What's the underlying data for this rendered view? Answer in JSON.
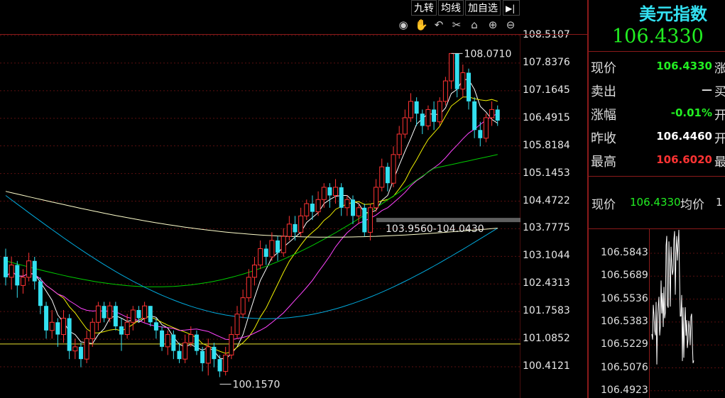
{
  "toolbar": {
    "jiuzhuan": "九转",
    "junxian": "均线",
    "add_watch": "加自选",
    "arrow": "▶|"
  },
  "icons": [
    "eye-icon",
    "hand-icon",
    "undo-icon",
    "scissors-icon",
    "lock-icon",
    "zoom-in-icon",
    "zoom-out-icon"
  ],
  "quote": {
    "title": "美元指数",
    "price": "106.4330",
    "rows": [
      {
        "label": "现价",
        "value": "106.4330",
        "color": "#22ee22",
        "tail": "涨"
      },
      {
        "label": "卖出",
        "value": "—",
        "color": "#dddddd",
        "tail": "买"
      },
      {
        "label": "涨幅",
        "value": "-0.01%",
        "color": "#22ee22",
        "tail": "开"
      },
      {
        "label": "昨收",
        "value": "106.4460",
        "color": "#ffffff",
        "tail": "开"
      },
      {
        "label": "最高",
        "value": "106.6020",
        "color": "#ff3333",
        "tail": "最"
      }
    ]
  },
  "mini": {
    "label_now": "现价",
    "now": "106.4330",
    "label_avg": "均价",
    "avg": "1"
  },
  "colors": {
    "up": "#ff3333",
    "down": "#33e0f0",
    "ma5": "#ffffff",
    "ma10": "#f0f000",
    "ma20": "#ff44ff",
    "ma30": "#00cc00",
    "ma60": "#00aadd",
    "ma120": "#ffffcc"
  },
  "chart_data": {
    "type": "candlestick",
    "yticks": [
      "108.5107",
      "107.8376",
      "107.1645",
      "106.4915",
      "105.8184",
      "105.1453",
      "104.4722",
      "103.7775",
      "103.1044",
      "102.4313",
      "101.7583",
      "101.0852",
      "100.4121"
    ],
    "ylim": [
      100.1,
      108.6
    ],
    "annotations": {
      "high_label": "108.0710",
      "low_label": "100.1570",
      "range_label": "103.9560-104.0430",
      "range_level": 104.0,
      "hline_level": 100.97
    },
    "candles": [
      [
        103.1,
        102.6,
        103.3,
        102.4
      ],
      [
        102.6,
        102.9,
        103.1,
        102.3
      ],
      [
        102.9,
        102.4,
        103.0,
        102.1
      ],
      [
        102.4,
        102.6,
        102.8,
        102.2
      ],
      [
        102.6,
        103.0,
        103.2,
        102.5
      ],
      [
        103.0,
        102.5,
        103.1,
        102.3
      ],
      [
        102.5,
        101.9,
        102.6,
        101.7
      ],
      [
        101.9,
        101.3,
        102.0,
        101.1
      ],
      [
        101.3,
        101.5,
        101.8,
        101.1
      ],
      [
        101.5,
        101.2,
        101.6,
        100.9
      ],
      [
        101.2,
        101.6,
        101.8,
        101.0
      ],
      [
        101.6,
        100.8,
        101.7,
        100.6
      ],
      [
        100.8,
        100.9,
        101.1,
        100.6
      ],
      [
        100.9,
        100.6,
        101.0,
        100.4
      ],
      [
        100.6,
        101.1,
        101.3,
        100.5
      ],
      [
        101.1,
        101.5,
        101.6,
        100.9
      ],
      [
        101.5,
        101.9,
        102.0,
        101.3
      ],
      [
        101.9,
        101.6,
        102.0,
        101.5
      ],
      [
        101.6,
        101.9,
        102.0,
        101.5
      ],
      [
        101.9,
        101.4,
        102.0,
        101.3
      ],
      [
        101.4,
        101.2,
        101.6,
        100.8
      ],
      [
        101.2,
        101.5,
        101.7,
        101.1
      ],
      [
        101.5,
        101.8,
        101.9,
        101.3
      ],
      [
        101.8,
        101.6,
        101.9,
        101.5
      ],
      [
        101.6,
        101.9,
        102.0,
        101.5
      ],
      [
        101.9,
        101.5,
        101.9,
        101.4
      ],
      [
        101.5,
        101.3,
        101.6,
        101.1
      ],
      [
        101.3,
        100.9,
        101.4,
        100.8
      ],
      [
        100.9,
        101.2,
        101.3,
        100.7
      ],
      [
        101.2,
        100.8,
        101.3,
        100.6
      ],
      [
        100.8,
        100.6,
        101.0,
        100.5
      ],
      [
        100.6,
        101.0,
        101.2,
        100.5
      ],
      [
        101.0,
        101.2,
        101.4,
        100.9
      ],
      [
        101.2,
        100.8,
        101.3,
        100.7
      ],
      [
        100.8,
        100.5,
        100.9,
        100.3
      ],
      [
        100.5,
        100.9,
        101.1,
        100.2
      ],
      [
        100.9,
        100.6,
        101.0,
        100.4
      ],
      [
        100.6,
        100.3,
        100.7,
        100.16
      ],
      [
        100.3,
        100.7,
        100.9,
        100.2
      ],
      [
        100.7,
        101.2,
        101.4,
        100.6
      ],
      [
        101.2,
        101.7,
        101.9,
        101.1
      ],
      [
        101.7,
        102.1,
        102.3,
        101.6
      ],
      [
        102.1,
        102.6,
        102.8,
        102.0
      ],
      [
        102.6,
        102.9,
        103.1,
        102.4
      ],
      [
        102.9,
        103.3,
        103.5,
        102.8
      ],
      [
        103.3,
        103.1,
        103.4,
        102.9
      ],
      [
        103.1,
        103.5,
        103.7,
        103.0
      ],
      [
        103.5,
        103.2,
        103.6,
        103.0
      ],
      [
        103.2,
        103.6,
        103.8,
        103.1
      ],
      [
        103.6,
        103.9,
        104.1,
        103.5
      ],
      [
        103.9,
        103.7,
        104.1,
        103.5
      ],
      [
        103.7,
        104.1,
        104.3,
        103.6
      ],
      [
        104.1,
        104.4,
        104.5,
        104.0
      ],
      [
        104.4,
        104.2,
        104.6,
        104.0
      ],
      [
        104.2,
        104.5,
        104.7,
        104.1
      ],
      [
        104.5,
        104.8,
        104.9,
        104.3
      ],
      [
        104.8,
        104.6,
        104.9,
        104.3
      ],
      [
        104.6,
        104.8,
        105.0,
        104.4
      ],
      [
        104.8,
        104.3,
        104.9,
        104.1
      ],
      [
        104.3,
        104.5,
        104.6,
        104.1
      ],
      [
        104.5,
        104.1,
        104.6,
        103.9
      ],
      [
        104.1,
        104.3,
        104.4,
        103.9
      ],
      [
        104.3,
        103.7,
        104.4,
        103.6
      ],
      [
        103.7,
        104.3,
        104.4,
        103.5
      ],
      [
        104.3,
        104.8,
        105.0,
        104.2
      ],
      [
        104.8,
        105.3,
        105.5,
        104.7
      ],
      [
        105.3,
        104.9,
        105.4,
        104.7
      ],
      [
        104.9,
        105.6,
        105.8,
        104.8
      ],
      [
        105.6,
        106.1,
        106.3,
        105.5
      ],
      [
        106.1,
        106.5,
        106.7,
        106.0
      ],
      [
        106.5,
        106.9,
        107.1,
        106.4
      ],
      [
        106.9,
        106.6,
        107.0,
        106.3
      ],
      [
        106.6,
        106.3,
        106.7,
        106.1
      ],
      [
        106.3,
        106.7,
        106.8,
        106.2
      ],
      [
        106.7,
        106.4,
        106.9,
        106.2
      ],
      [
        106.4,
        106.9,
        107.0,
        106.3
      ],
      [
        106.9,
        107.4,
        107.5,
        106.8
      ],
      [
        107.4,
        108.07,
        108.07,
        107.2
      ],
      [
        108.07,
        107.2,
        108.07,
        107.0
      ],
      [
        107.2,
        107.6,
        107.8,
        107.0
      ],
      [
        107.6,
        106.9,
        107.7,
        106.7
      ],
      [
        106.9,
        106.2,
        107.0,
        106.0
      ],
      [
        106.2,
        106.0,
        106.4,
        105.8
      ],
      [
        106.0,
        106.5,
        106.6,
        105.9
      ],
      [
        106.5,
        106.7,
        106.9,
        106.3
      ],
      [
        106.7,
        106.43,
        106.8,
        106.3
      ]
    ]
  }
}
